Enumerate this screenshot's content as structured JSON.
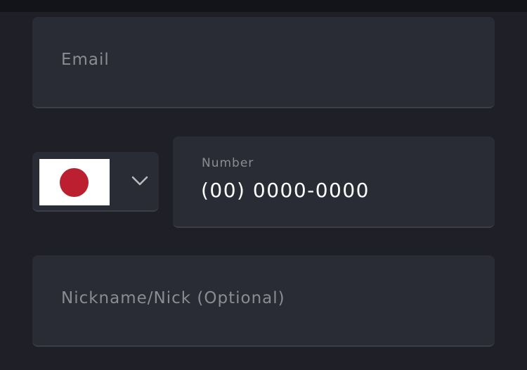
{
  "form": {
    "email": {
      "placeholder": "Email"
    },
    "phone": {
      "country_flag": "japan-flag",
      "label": "Number",
      "value": "(00) 0000-0000"
    },
    "nickname": {
      "placeholder": "Nickname/Nick (Optional)"
    }
  },
  "colors": {
    "background": "#1f2027",
    "field": "#2a2c35",
    "placeholder": "#8b8c93",
    "flag_red": "#bc1f2f"
  }
}
